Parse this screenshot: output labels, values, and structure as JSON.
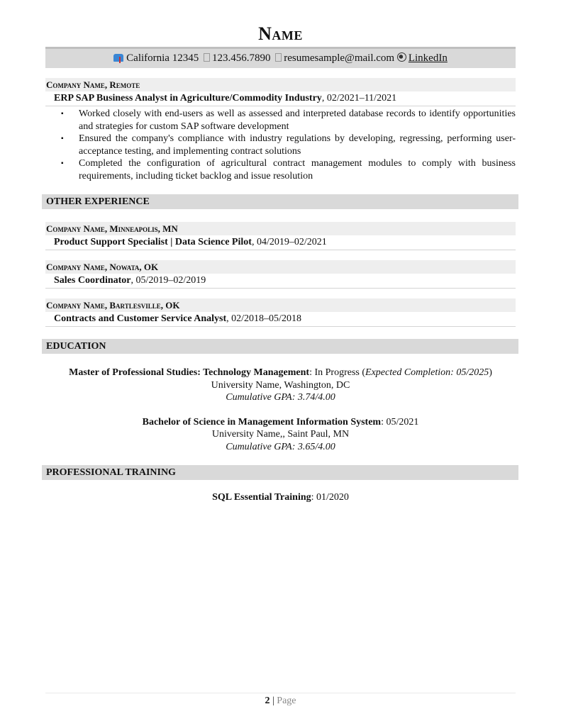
{
  "header": {
    "name": "Name",
    "contact": {
      "location": "California 12345",
      "phone": "123.456.7890",
      "email": "resumesample@mail.com",
      "linkedin": "LinkedIn"
    }
  },
  "experience": {
    "company": "Company Name, Remote",
    "title": "ERP SAP Business Analyst in Agriculture/Commodity Industry",
    "dates": ", 02/2021–11/2021",
    "bullets": [
      "Worked closely with end-users as well as assessed and interpreted database records to identify opportunities and strategies for custom SAP software development",
      "Ensured the company's compliance with industry regulations by developing, regressing, performing user-acceptance testing, and implementing contract solutions",
      "Completed the configuration of agricultural contract management modules to comply with business requirements, including ticket backlog and issue resolution"
    ]
  },
  "other_experience": {
    "heading": "OTHER EXPERIENCE",
    "jobs": [
      {
        "company": "Company Name, Minneapolis, MN",
        "title": "Product Support Specialist | Data Science Pilot",
        "dates": ", 04/2019–02/2021"
      },
      {
        "company": "Company Name, Nowata, OK",
        "title": "Sales Coordinator",
        "dates": ", 05/2019–02/2019"
      },
      {
        "company": "Company Name, Bartlesville, OK",
        "title": "Contracts and Customer Service Analyst",
        "dates": ", 02/2018–05/2018"
      }
    ]
  },
  "education": {
    "heading": "EDUCATION",
    "degrees": [
      {
        "degree": "Master of Professional Studies: Technology Management",
        "status": ": In Progress (",
        "note": "Expected Completion: 05/2025",
        "close": ")",
        "school": "University Name, Washington, DC",
        "gpa": "Cumulative GPA: 3.74/4.00"
      },
      {
        "degree": "Bachelor of Science in Management Information System",
        "status": ": 05/2021",
        "note": "",
        "close": "",
        "school": "University Name,, Saint Paul, MN",
        "gpa": "Cumulative GPA: 3.65/4.00"
      }
    ]
  },
  "training": {
    "heading": "PROFESSIONAL TRAINING",
    "item": "SQL Essential Training",
    "date": ": 01/2020"
  },
  "footer": {
    "page_number": "2",
    "separator": " | ",
    "page_label": "Page"
  }
}
